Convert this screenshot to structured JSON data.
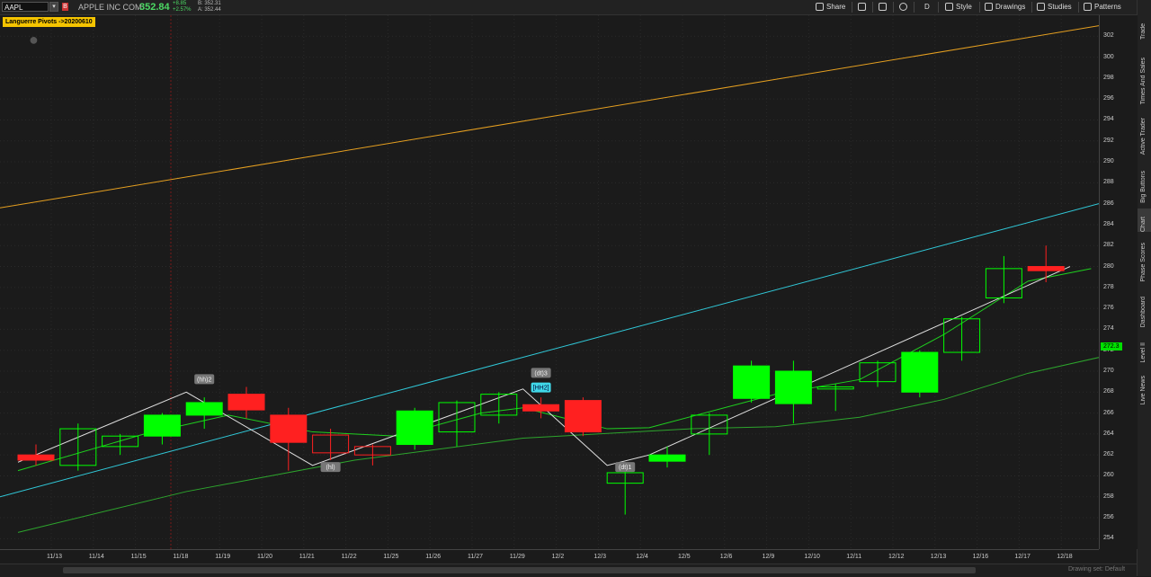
{
  "header": {
    "symbol": "AAPL",
    "flag": "B",
    "company": "APPLE INC COM",
    "price": "352.84",
    "change": "+8.85",
    "change_pct": "+2.57%",
    "bid": "B: 352.31",
    "ask": "A: 352.44",
    "toolbar": {
      "share": "Share",
      "period": "D",
      "style": "Style",
      "drawings": "Drawings",
      "studies": "Studies",
      "patterns": "Patterns"
    }
  },
  "sidebar": {
    "tabs": [
      "Trade",
      "Times And Sales",
      "Active Trader",
      "Big Buttons",
      "Chart",
      "Phase Scores",
      "Dashboard",
      "Level II",
      "Live News"
    ],
    "active": "Chart"
  },
  "study_label": "Languerre Pivots ->20200610",
  "status": {
    "drawing": "Drawing set: Default"
  },
  "colors": {
    "bull": "#00ff00",
    "bear": "#ff2020",
    "orange_line": "#e6a020",
    "cyan_line": "#30c8d8",
    "price_tag": "#00e000"
  },
  "chart_data": {
    "type": "candlestick",
    "x": [
      "11/13",
      "11/14",
      "11/15",
      "11/18",
      "11/19",
      "11/20",
      "11/21",
      "11/22",
      "11/25",
      "11/26",
      "11/27",
      "11/29",
      "12/2",
      "12/3",
      "12/4",
      "12/5",
      "12/6",
      "12/9",
      "12/10",
      "12/11",
      "12/12",
      "12/13",
      "12/16",
      "12/17",
      "12/18"
    ],
    "ohlc": [
      [
        262.0,
        263.0,
        261.0,
        261.5
      ],
      [
        261.0,
        265.0,
        260.5,
        264.5
      ],
      [
        262.8,
        264.0,
        262.0,
        263.8
      ],
      [
        263.8,
        266.0,
        263.0,
        265.8
      ],
      [
        265.8,
        267.5,
        264.5,
        267.0
      ],
      [
        267.8,
        268.5,
        265.5,
        266.3
      ],
      [
        265.8,
        266.5,
        260.5,
        263.2
      ],
      [
        263.9,
        264.5,
        261.5,
        262.2
      ],
      [
        262.8,
        263.0,
        261.0,
        262.0
      ],
      [
        263.0,
        266.5,
        262.5,
        266.2
      ],
      [
        264.2,
        267.2,
        262.8,
        267.0
      ],
      [
        265.8,
        268.0,
        265.0,
        267.8
      ],
      [
        266.8,
        267.5,
        265.5,
        266.2
      ],
      [
        267.2,
        267.5,
        263.8,
        264.2
      ],
      [
        259.3,
        260.5,
        256.3,
        260.3
      ],
      [
        261.4,
        262.8,
        260.8,
        262.0
      ],
      [
        264.0,
        266.0,
        262.0,
        265.8
      ],
      [
        267.4,
        271.0,
        267.0,
        270.5
      ],
      [
        266.9,
        271.0,
        265.0,
        270.0
      ],
      [
        268.3,
        268.8,
        266.2,
        268.5
      ],
      [
        269.0,
        271.0,
        268.5,
        270.8
      ],
      [
        268.0,
        272.0,
        267.5,
        271.8
      ],
      [
        271.8,
        275.2,
        271.0,
        275.0
      ],
      [
        277.0,
        281.0,
        276.5,
        279.8
      ],
      [
        280.0,
        282.0,
        278.5,
        279.6
      ],
      [
        280.0,
        282.0,
        279.0,
        279.6
      ]
    ],
    "ohlc_note": "",
    "ylim": [
      253,
      304
    ],
    "yticks": [
      254,
      256,
      258,
      260,
      262,
      264,
      266,
      268,
      270,
      272,
      274,
      276,
      278,
      280,
      282,
      284,
      286,
      288,
      290,
      292,
      294,
      296,
      298,
      300,
      302
    ],
    "last_price_tag": "272.3",
    "pivot_labels": [
      {
        "text": "(hh)2",
        "x": "11/19",
        "y": 269.2,
        "style": "gray"
      },
      {
        "text": "(hl)",
        "x": "11/22",
        "y": 260.8,
        "style": "gray"
      },
      {
        "text": "(dt)3",
        "x": "12/2",
        "y": 269.8,
        "style": "gray"
      },
      {
        "text": "[HH2]",
        "x": "12/2",
        "y": 268.4,
        "style": "cyan"
      },
      {
        "text": "(dt)1",
        "x": "12/4",
        "y": 260.8,
        "style": "gray"
      }
    ],
    "zigzag": [
      [
        0,
        261.3
      ],
      [
        4,
        268.0
      ],
      [
        7,
        261.0
      ],
      [
        12,
        268.3
      ],
      [
        14,
        261.0
      ],
      [
        15,
        262.0
      ],
      [
        25,
        280.0
      ]
    ],
    "orange_trend": [
      [
        0,
        285.6
      ],
      [
        26,
        303.0
      ]
    ],
    "cyan_trend": [
      [
        0,
        258.0
      ],
      [
        26,
        286.0
      ]
    ]
  }
}
